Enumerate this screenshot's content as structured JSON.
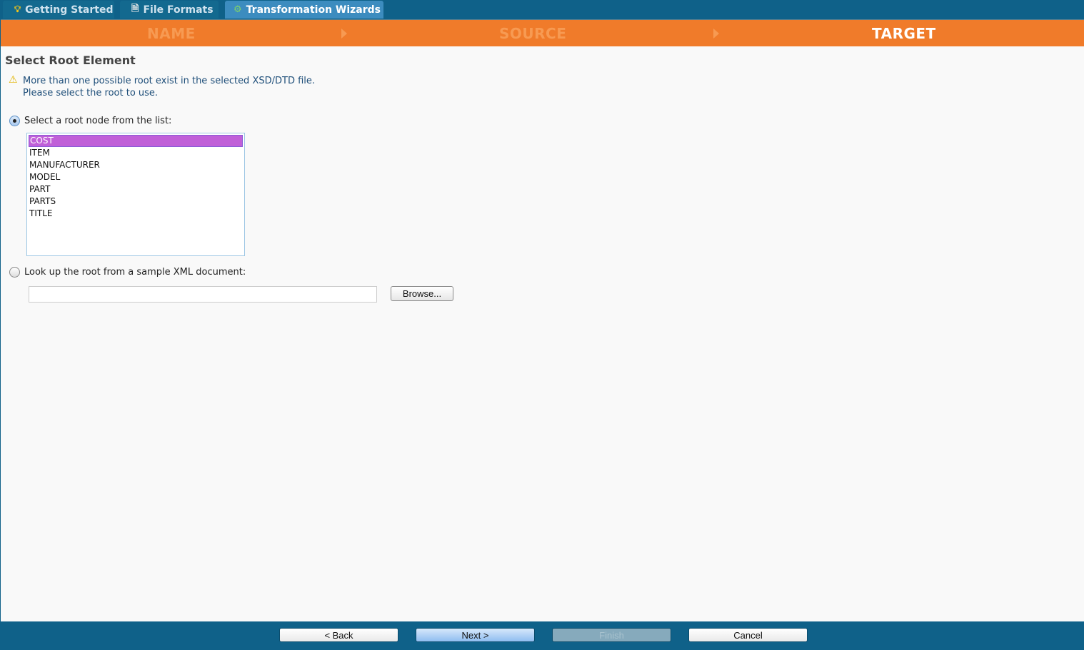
{
  "tabs": [
    {
      "label": "Getting Started",
      "icon": "lightbulb-icon",
      "active": false
    },
    {
      "label": "File Formats",
      "icon": "document-icon",
      "active": false
    },
    {
      "label": "Transformation Wizards",
      "icon": "wizard-icon",
      "active": true
    }
  ],
  "wizard": {
    "steps": [
      {
        "label": "NAME",
        "active": false
      },
      {
        "label": "SOURCE",
        "active": false
      },
      {
        "label": "TARGET",
        "active": true
      }
    ]
  },
  "page": {
    "title": "Select Root Element",
    "warning_line1": "More than one possible root exist in the selected XSD/DTD file.",
    "warning_line2": "Please select the root to use.",
    "option_list_label": "Select a root node from the list:",
    "option_list_checked": true,
    "root_nodes": [
      "COST",
      "ITEM",
      "MANUFACTURER",
      "MODEL",
      "PART",
      "PARTS",
      "TITLE"
    ],
    "selected_root": "COST",
    "option_sample_label": "Look up the root from a sample XML document:",
    "option_sample_checked": false,
    "sample_path_value": "",
    "browse_label": "Browse..."
  },
  "footer": {
    "back_label": "< Back",
    "next_label": "Next >",
    "finish_label": "Finish",
    "cancel_label": "Cancel"
  }
}
